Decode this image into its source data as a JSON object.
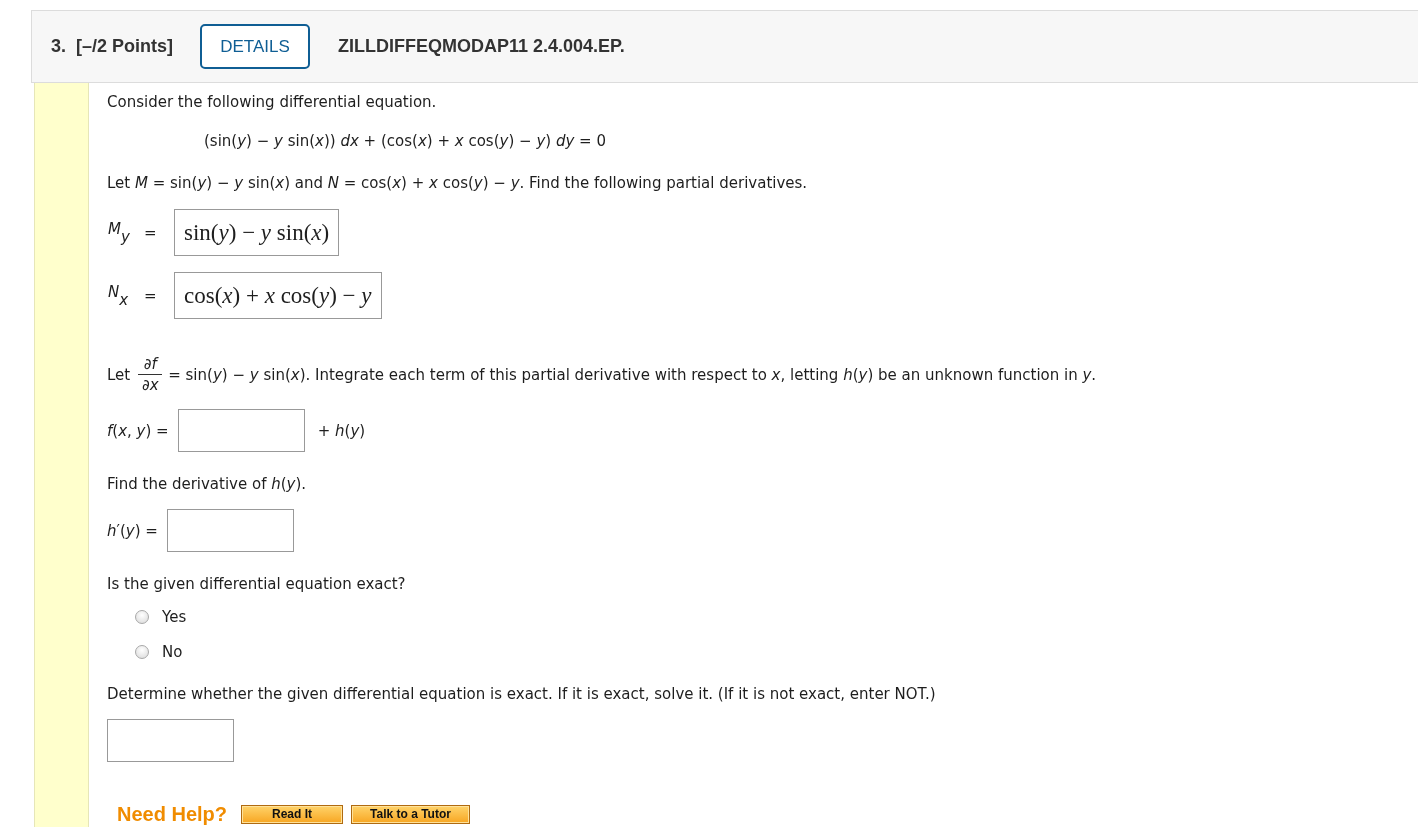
{
  "header": {
    "number": "3.",
    "points": "[–/2 Points]",
    "details_button": "DETAILS",
    "code": "ZILLDIFFEQMODAP11 2.4.004.EP."
  },
  "parts": [
    {
      "kind": "text",
      "text": "Consider the following differential equation."
    },
    {
      "kind": "equation",
      "text": "(sin(*y*) − *y* sin(*x*)) *dx* + (cos(*x*) + *x* cos(*y*) − *y*) *dy* = 0"
    },
    {
      "kind": "text",
      "text": "Let *M* = sin(*y*) − *y* sin(*x*) and *N* = cos(*x*) + *x* cos(*y*) − *y*. Find the following partial derivatives."
    },
    {
      "kind": "partial",
      "symbol": "M",
      "subscript": "y",
      "relation": "=",
      "answer": "sin(*y*) − *y* sin(*x*)"
    },
    {
      "kind": "partial",
      "symbol": "N",
      "subscript": "x",
      "relation": "=",
      "answer": "cos(*x*) + *x* cos(*y*) − *y*"
    },
    {
      "kind": "fraction_text",
      "lead": "Let",
      "numerator": "∂*f*",
      "denominator": "∂*x*",
      "text": "= sin(*y*) − *y* sin(*x*). Integrate each term of this partial derivative with respect to *x*, letting *h*(*y*) be an unknown function in *y*."
    },
    {
      "kind": "blank",
      "label": "*f*(*x*, *y*) =",
      "suffix": "+ *h*(*y*)"
    },
    {
      "kind": "text",
      "text": "Find the derivative of *h*(*y*)."
    },
    {
      "kind": "blank",
      "label": "*h*′(*y*) ="
    },
    {
      "kind": "text",
      "text": "Is the given differential equation exact?"
    },
    {
      "kind": "choices",
      "options": [
        {
          "label": "Yes",
          "selected": false
        },
        {
          "label": "No",
          "selected": false
        }
      ]
    },
    {
      "kind": "text",
      "text": "Determine whether the given differential equation is exact. If it is exact, solve it. (If it is not exact, enter NOT.)"
    },
    {
      "kind": "blank"
    }
  ],
  "help": {
    "label": "Need Help?",
    "buttons": [
      "Read It",
      "Talk to a Tutor"
    ]
  }
}
